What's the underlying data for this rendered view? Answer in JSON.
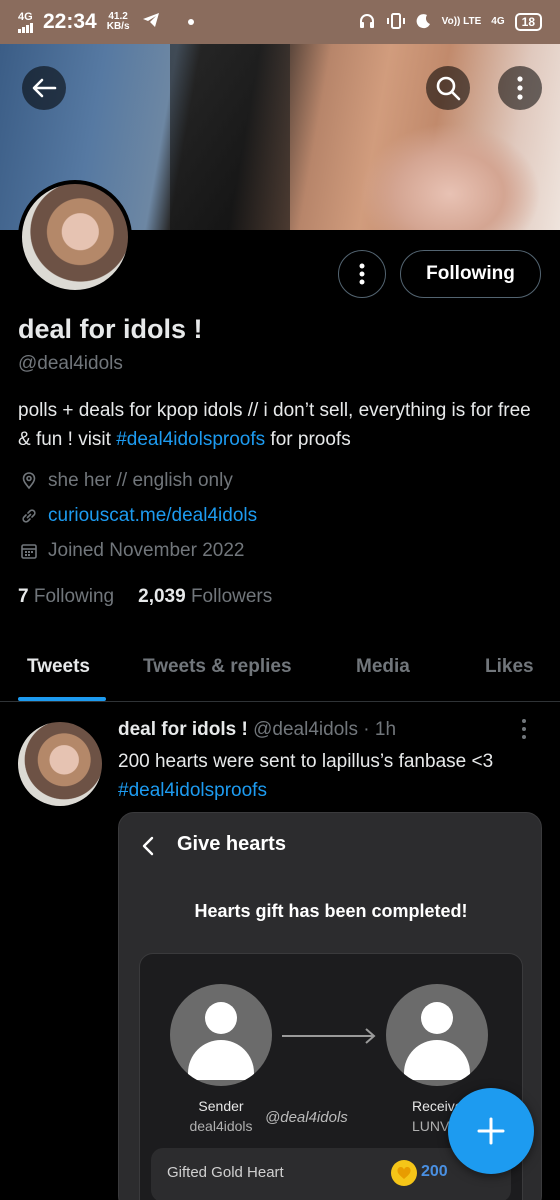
{
  "status_bar": {
    "network": "4G",
    "time": "22:34",
    "speed_value": "41.2",
    "speed_unit": "KB/s",
    "volte": "Vo)) LTE",
    "lte2": "4G",
    "battery": "18"
  },
  "profile": {
    "name": "deal for idols !",
    "handle": "@deal4idols",
    "bio_text": "polls + deals for kpop idols // i don’t sell, everything is for free & fun ! visit ",
    "bio_hashtag": "#deal4idolsproofs",
    "bio_suffix": " for proofs",
    "location": "she her // english only",
    "website": "curiouscat.me/deal4idols",
    "joined": "Joined November 2022",
    "following_count": "7",
    "following_label": "Following",
    "followers_count": "2,039",
    "followers_label": "Followers",
    "follow_button": "Following"
  },
  "tabs": [
    {
      "label": "Tweets",
      "active": true
    },
    {
      "label": "Tweets & replies",
      "active": false
    },
    {
      "label": "Media",
      "active": false
    },
    {
      "label": "Likes",
      "active": false
    }
  ],
  "tweet": {
    "name": "deal for idols !",
    "handle": "@deal4idols",
    "separator": "·",
    "time": "1h",
    "text": "200 hearts were sent to lapillus’s fanbase <3",
    "hashtag": "#deal4idolsproofs",
    "media": {
      "title": "Give hearts",
      "subtitle": "Hearts gift has been completed!",
      "sender_label": "Sender",
      "sender_name": "deal4idols",
      "receiver_label": "Receiver",
      "receiver_name": "LUNV",
      "watermark": "@deal4idols",
      "gift_label": "Gifted Gold Heart",
      "gift_value": "200"
    }
  },
  "colors": {
    "accent": "#1d9bf0",
    "background": "#000000",
    "muted": "#71767b"
  }
}
